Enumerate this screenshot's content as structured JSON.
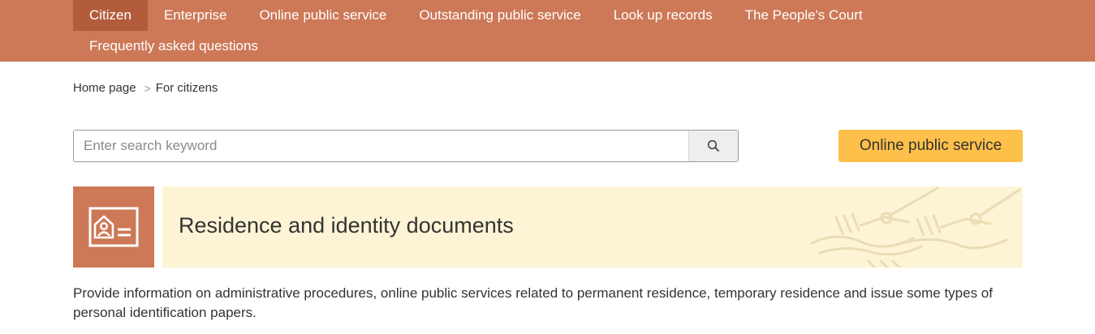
{
  "nav": {
    "items": [
      {
        "label": "Citizen",
        "active": true
      },
      {
        "label": "Enterprise"
      },
      {
        "label": "Online public service"
      },
      {
        "label": "Outstanding public service"
      },
      {
        "label": "Look up records"
      },
      {
        "label": "The People's Court"
      },
      {
        "label": "Frequently asked questions"
      }
    ]
  },
  "breadcrumb": {
    "home": "Home page",
    "separator": ">",
    "current": "For citizens"
  },
  "search": {
    "placeholder": "Enter search keyword",
    "value": "",
    "icon": "search-icon"
  },
  "online_service_button": {
    "label": "Online public service"
  },
  "category": {
    "icon": "id-card-icon",
    "title": "Residence and identity documents",
    "description": "Provide information on administrative procedures, online public services related to permanent residence, temporary residence and issue some types of personal identification papers."
  },
  "colors": {
    "nav_bg": "#cd7857",
    "nav_active": "#b35c3b",
    "accent_button": "#fdc04a",
    "banner_bg": "#fdf4d6"
  }
}
